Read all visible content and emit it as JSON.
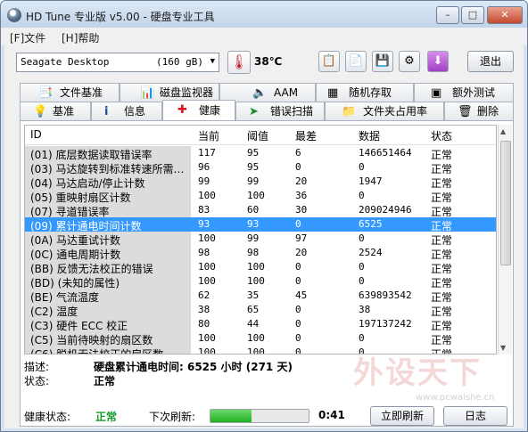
{
  "window": {
    "title": "HD Tune 专业版 v5.00 - 硬盘专业工具"
  },
  "menu": [
    "[F]文件",
    "[H]帮助"
  ],
  "toolbar": {
    "drive_name": "Seagate Desktop",
    "drive_capacity": "(160 gB)",
    "temperature": "38℃",
    "exit_label": "退出"
  },
  "tabs_row1": [
    {
      "label": "文件基准",
      "icon": "file-benchmark-icon"
    },
    {
      "label": "磁盘监视器",
      "icon": "disk-monitor-icon"
    },
    {
      "label": "AAM",
      "icon": "speaker-icon"
    },
    {
      "label": "随机存取",
      "icon": "random-access-icon"
    },
    {
      "label": "额外测试",
      "icon": "extra-tests-icon"
    }
  ],
  "tabs_row2": [
    {
      "label": "基准",
      "icon": "lightbulb-icon"
    },
    {
      "label": "信息",
      "icon": "info-icon"
    },
    {
      "label": "健康",
      "icon": "red-cross-icon",
      "active": true
    },
    {
      "label": "错误扫描",
      "icon": "green-arrow-icon"
    },
    {
      "label": "文件夹占用率",
      "icon": "folder-icon"
    },
    {
      "label": "删除",
      "icon": "trash-icon"
    }
  ],
  "table": {
    "headers": [
      "ID",
      "当前",
      "阈值",
      "最差",
      "数据",
      "状态"
    ],
    "rows": [
      {
        "id": "(01) 底层数据读取错误率",
        "current": "117",
        "threshold": "95",
        "worst": "6",
        "data": "146651464",
        "status": "正常"
      },
      {
        "id": "(03) 马达旋转到标准转速所需…",
        "current": "96",
        "threshold": "95",
        "worst": "0",
        "data": "0",
        "status": "正常"
      },
      {
        "id": "(04) 马达启动/停止计数",
        "current": "99",
        "threshold": "99",
        "worst": "20",
        "data": "1947",
        "status": "正常"
      },
      {
        "id": "(05) 重映射扇区计数",
        "current": "100",
        "threshold": "100",
        "worst": "36",
        "data": "0",
        "status": "正常"
      },
      {
        "id": "(07) 寻道错误率",
        "current": "83",
        "threshold": "60",
        "worst": "30",
        "data": "209024946",
        "status": "正常"
      },
      {
        "id": "(09) 累计通电时间计数",
        "current": "93",
        "threshold": "93",
        "worst": "0",
        "data": "6525",
        "status": "正常",
        "selected": true
      },
      {
        "id": "(0A) 马达重试计数",
        "current": "100",
        "threshold": "99",
        "worst": "97",
        "data": "0",
        "status": "正常"
      },
      {
        "id": "(0C) 通电周期计数",
        "current": "98",
        "threshold": "98",
        "worst": "20",
        "data": "2524",
        "status": "正常"
      },
      {
        "id": "(BB) 反馈无法校正的错误",
        "current": "100",
        "threshold": "100",
        "worst": "0",
        "data": "0",
        "status": "正常"
      },
      {
        "id": "(BD) (未知的属性)",
        "current": "100",
        "threshold": "100",
        "worst": "0",
        "data": "0",
        "status": "正常"
      },
      {
        "id": "(BE) 气流温度",
        "current": "62",
        "threshold": "35",
        "worst": "45",
        "data": "639893542",
        "status": "正常"
      },
      {
        "id": "(C2) 温度",
        "current": "38",
        "threshold": "65",
        "worst": "0",
        "data": "38",
        "status": "正常"
      },
      {
        "id": "(C3) 硬件 ECC 校正",
        "current": "80",
        "threshold": "44",
        "worst": "0",
        "data": "197137242",
        "status": "正常"
      },
      {
        "id": "(C5) 当前待映射的扇区数",
        "current": "100",
        "threshold": "100",
        "worst": "0",
        "data": "0",
        "status": "正常"
      },
      {
        "id": "(C6) 脱机无法校正的扇区数",
        "current": "100",
        "threshold": "100",
        "worst": "0",
        "data": "0",
        "status": "正常"
      }
    ]
  },
  "details": {
    "desc_label": "描述:",
    "desc_value": "硬盘累计通电时间: 6525 小时 (271 天)",
    "status_label": "状态:",
    "status_value": "正常"
  },
  "bottom": {
    "health_label": "健康状态:",
    "health_value": "正常",
    "next_refresh_label": "下次刷新:",
    "progress_percent": 42,
    "timer": "0:41",
    "refresh_label": "立即刷新",
    "log_label": "日志"
  },
  "watermark": {
    "text": "外设天下",
    "url": "www.pcwaishe.cn"
  },
  "colors": {
    "selection": "#3399ff",
    "health_ok": "#1a9a2a",
    "temp_red": "#c0181c"
  }
}
